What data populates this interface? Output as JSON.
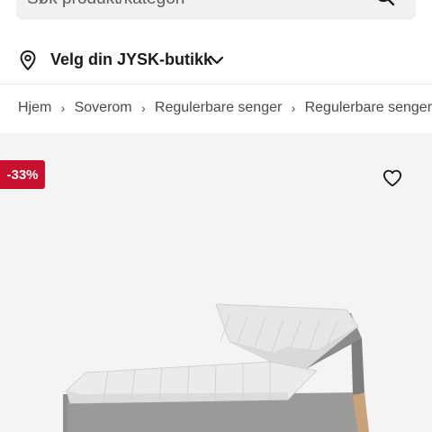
{
  "search": {
    "placeholder": "Søk produkt/kategori"
  },
  "store": {
    "label": "Velg din JYSK-butikk"
  },
  "breadcrumb": {
    "items": [
      "Hjem",
      "Soverom",
      "Regulerbare senger",
      "Regulerbare senger"
    ]
  },
  "product": {
    "discount": "-33%",
    "badge_color": "#c8102e"
  }
}
